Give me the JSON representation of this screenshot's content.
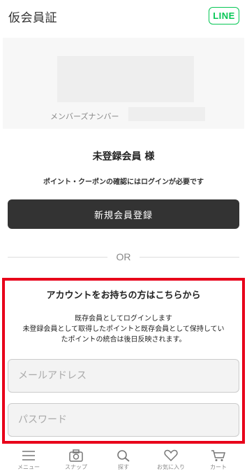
{
  "header": {
    "title": "仮会員証",
    "line_label": "LINE"
  },
  "member_card": {
    "number_label": "メンバーズナンバー"
  },
  "guest": {
    "name": "未登録会員 様",
    "login_note": "ポイント・クーポンの確認にはログインが必要です"
  },
  "register_button": "新規会員登録",
  "or_text": "OR",
  "login_section": {
    "title": "アカウントをお持ちの方はこちらから",
    "desc_lines": [
      "既存会員としてログインします",
      "未登録会員として取得したポイントと既存会員として保持してい",
      "たポイントの統合は後日反映されます。"
    ],
    "email_placeholder": "メールアドレス",
    "password_placeholder": "パスワード"
  },
  "tabbar": {
    "items": [
      {
        "label": "メニュー",
        "icon": "menu-icon"
      },
      {
        "label": "スナップ",
        "icon": "camera-icon"
      },
      {
        "label": "探す",
        "icon": "search-icon"
      },
      {
        "label": "お気に入り",
        "icon": "heart-icon"
      },
      {
        "label": "カート",
        "icon": "cart-icon"
      }
    ]
  },
  "colors": {
    "line_green": "#06C755",
    "highlight_red": "#E8001A",
    "button_dark": "#333333"
  }
}
